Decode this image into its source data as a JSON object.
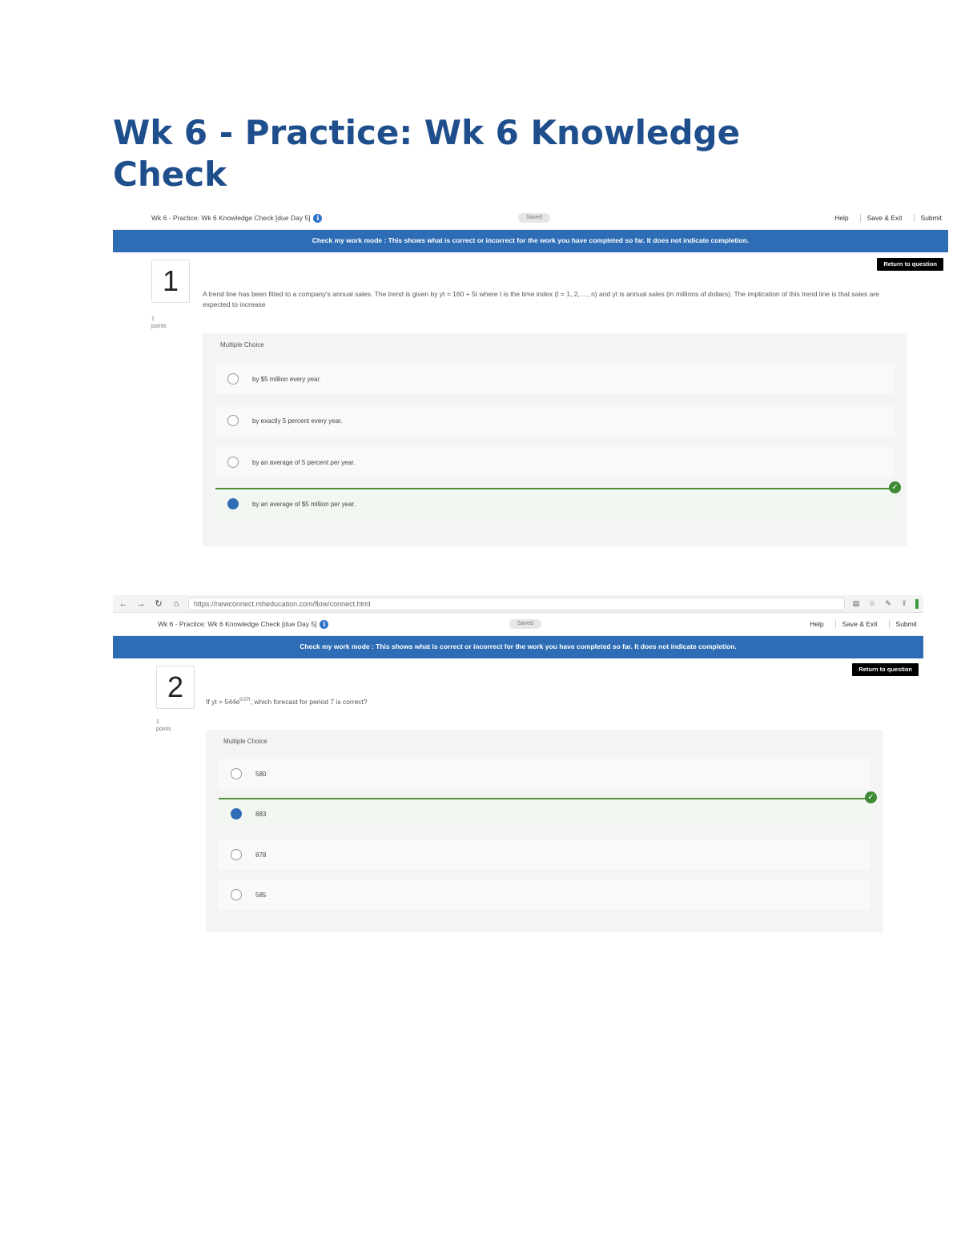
{
  "document": {
    "title": "Wk 6 - Practice: Wk 6 Knowledge Check"
  },
  "screenshot1": {
    "assignment_title": "Wk 6 - Practice: Wk 6 Knowledge Check [due Day 5]",
    "saved_label": "Saved",
    "help_label": "Help",
    "save_exit_label": "Save & Exit",
    "submit_label": "Submit",
    "mode_banner": "Check my work mode : This shows what is correct or incorrect for the work you have completed so far. It does not indicate completion.",
    "return_label": "Return to question",
    "question_number": "1",
    "points_value": "1",
    "points_label": "points",
    "question_text": "A trend line has been fitted to a company's annual sales. The trend is given by yt = 160 + 5t where t is the time index (t = 1, 2, ..., n) and yt is annual sales (in millions of dollars). The implication of this trend line is that sales are expected to increase",
    "choices_label": "Multiple Choice",
    "options": [
      {
        "text": "by $5 million every year.",
        "selected": false,
        "correct": false
      },
      {
        "text": "by exactly 5 percent every year.",
        "selected": false,
        "correct": false
      },
      {
        "text": "by an average of 5 percent per year.",
        "selected": false,
        "correct": false
      },
      {
        "text": "by an average of $5 million per year.",
        "selected": true,
        "correct": true
      }
    ]
  },
  "screenshot2": {
    "browser": {
      "url": "https://newconnect.mheducation.com/flow/connect.html"
    },
    "assignment_title": "Wk 6 - Practice: Wk 6 Knowledge Check [due Day 5]",
    "saved_label": "Saved",
    "help_label": "Help",
    "save_exit_label": "Save & Exit",
    "submit_label": "Submit",
    "mode_banner": "Check my work mode : This shows what is correct or incorrect for the work you have completed so far. It does not indicate completion.",
    "return_label": "Return to question",
    "question_number": "2",
    "points_value": "1",
    "points_label": "points",
    "question_prefix": "If yt = 544e",
    "question_exponent": "0.07t",
    "question_suffix": ", which forecast for period 7 is correct?",
    "choices_label": "Multiple Choice",
    "options": [
      {
        "text": "580",
        "selected": false,
        "correct": false
      },
      {
        "text": "883",
        "selected": true,
        "correct": true
      },
      {
        "text": "878",
        "selected": false,
        "correct": false
      },
      {
        "text": "585",
        "selected": false,
        "correct": false
      }
    ]
  },
  "colors": {
    "title": "#1f4e8c",
    "mode_banner": "#2e6db5",
    "correct": "#3f8a35"
  }
}
